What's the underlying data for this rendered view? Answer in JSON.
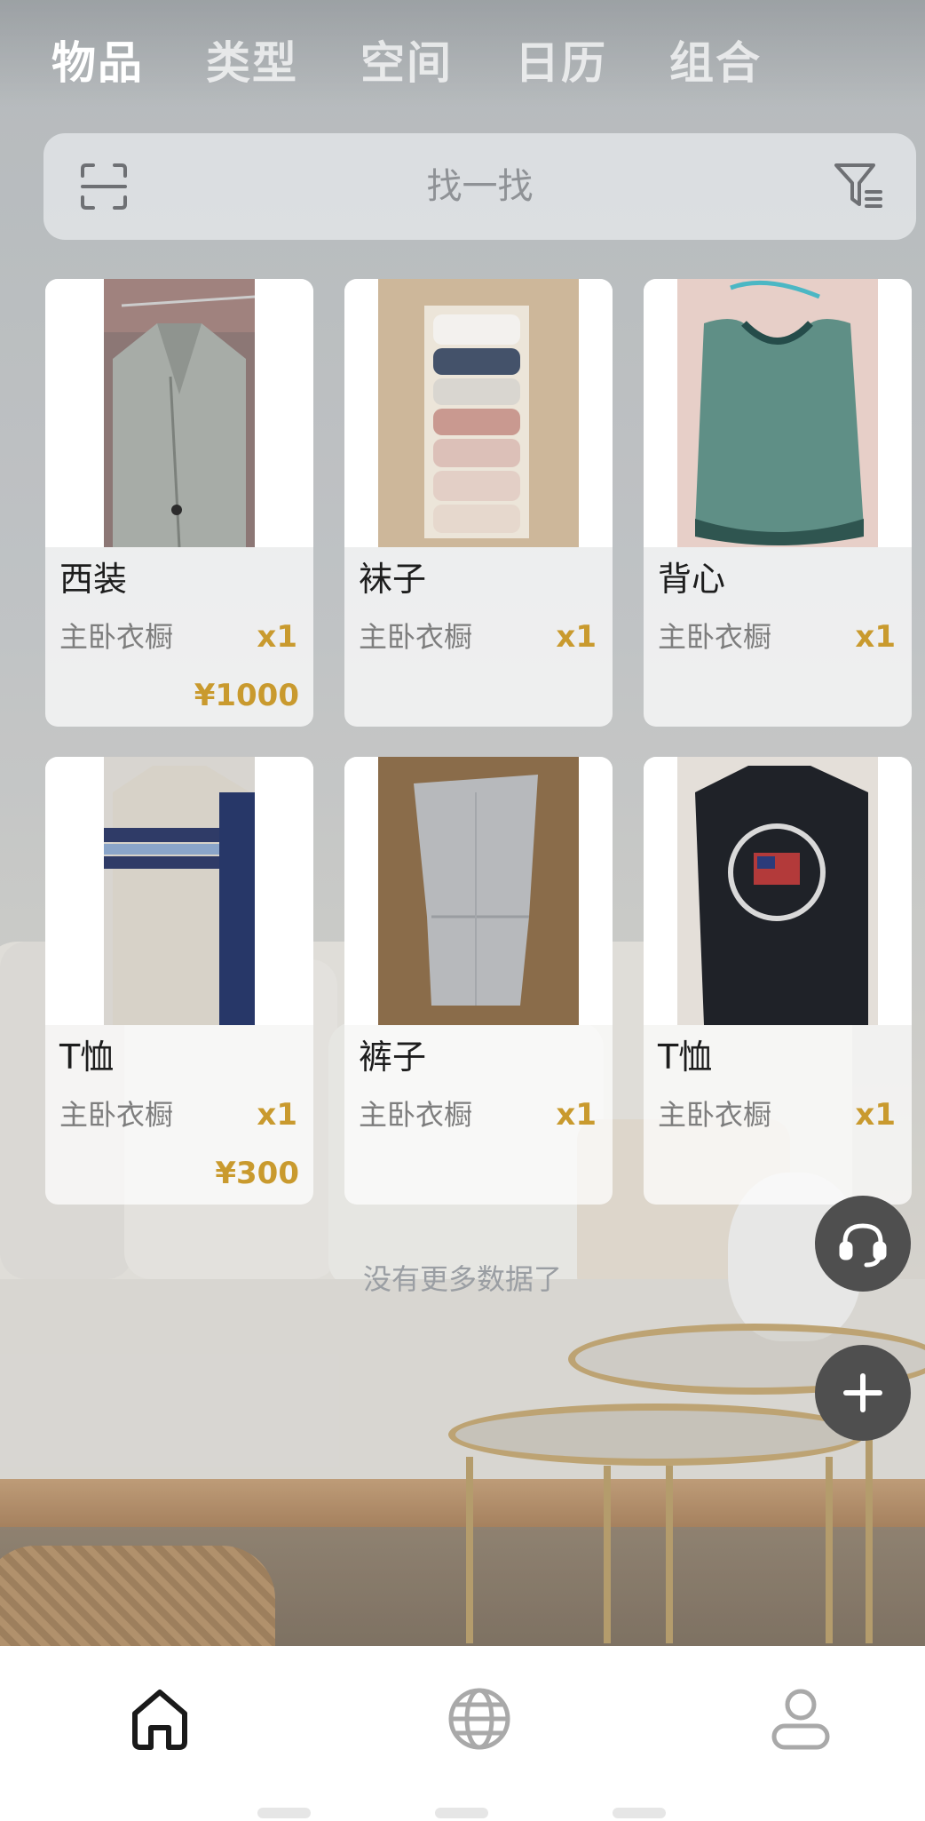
{
  "top_tabs": [
    {
      "label": "物品",
      "active": true
    },
    {
      "label": "类型",
      "active": false
    },
    {
      "label": "空间",
      "active": false
    },
    {
      "label": "日历",
      "active": false
    },
    {
      "label": "组合",
      "active": false
    }
  ],
  "search": {
    "placeholder": "找一找",
    "scan_icon": "scan-icon",
    "filter_icon": "filter-icon"
  },
  "items": [
    {
      "name": "西装",
      "location": "主卧衣橱",
      "quantity": "x1",
      "price": "¥1000",
      "image": "gray-suit-jacket"
    },
    {
      "name": "袜子",
      "location": "主卧衣橱",
      "quantity": "x1",
      "price": "",
      "image": "folded-socks-box"
    },
    {
      "name": "背心",
      "location": "主卧衣橱",
      "quantity": "x1",
      "price": "",
      "image": "green-tank-top"
    },
    {
      "name": "T恤",
      "location": "主卧衣橱",
      "quantity": "x1",
      "price": "¥300",
      "image": "striped-tshirt"
    },
    {
      "name": "裤子",
      "location": "主卧衣橱",
      "quantity": "x1",
      "price": "",
      "image": "gray-pants"
    },
    {
      "name": "T恤",
      "location": "主卧衣橱",
      "quantity": "x1",
      "price": "",
      "image": "black-graphic-tshirt"
    }
  ],
  "list_footer": "没有更多数据了",
  "floating_buttons": {
    "service": "headset-icon",
    "add": "plus-icon"
  },
  "bottom_nav": [
    {
      "icon": "home-icon",
      "active": true
    },
    {
      "icon": "globe-icon",
      "active": false
    },
    {
      "icon": "user-icon",
      "active": false
    }
  ],
  "colors": {
    "accent_price": "#c99a2e",
    "fab": "#4f4f4f"
  }
}
